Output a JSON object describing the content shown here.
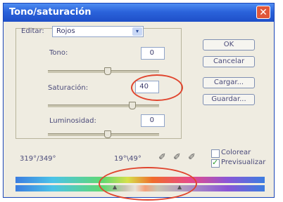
{
  "window": {
    "title": "Tono/saturación",
    "close_glyph": "✕"
  },
  "edit": {
    "label": "Editar:",
    "value": "Rojos",
    "arrow": "▾"
  },
  "hue": {
    "label": "Tono:",
    "value": "0",
    "level": 0.5
  },
  "saturation": {
    "label": "Saturación:",
    "value": "40",
    "level": 0.6
  },
  "lightness": {
    "label": "Luminosidad:",
    "value": "0",
    "level": 0.5
  },
  "buttons": {
    "ok": "OK",
    "cancel": "Cancelar",
    "load": "Cargar...",
    "save": "Guardar..."
  },
  "range": {
    "left": "319°/349°",
    "right": "19°\\49°"
  },
  "options": {
    "colorize": "Colorear",
    "colorize_checked": false,
    "preview": "Previsualizar",
    "preview_checked": true
  },
  "icons": [
    "eyedropper-icon",
    "eyedropper-plus-icon",
    "eyedropper-minus-icon"
  ],
  "colors": {
    "title_bar": "#2b63db",
    "annotation": "#e0452e",
    "dialog_bg": "#efece1"
  }
}
